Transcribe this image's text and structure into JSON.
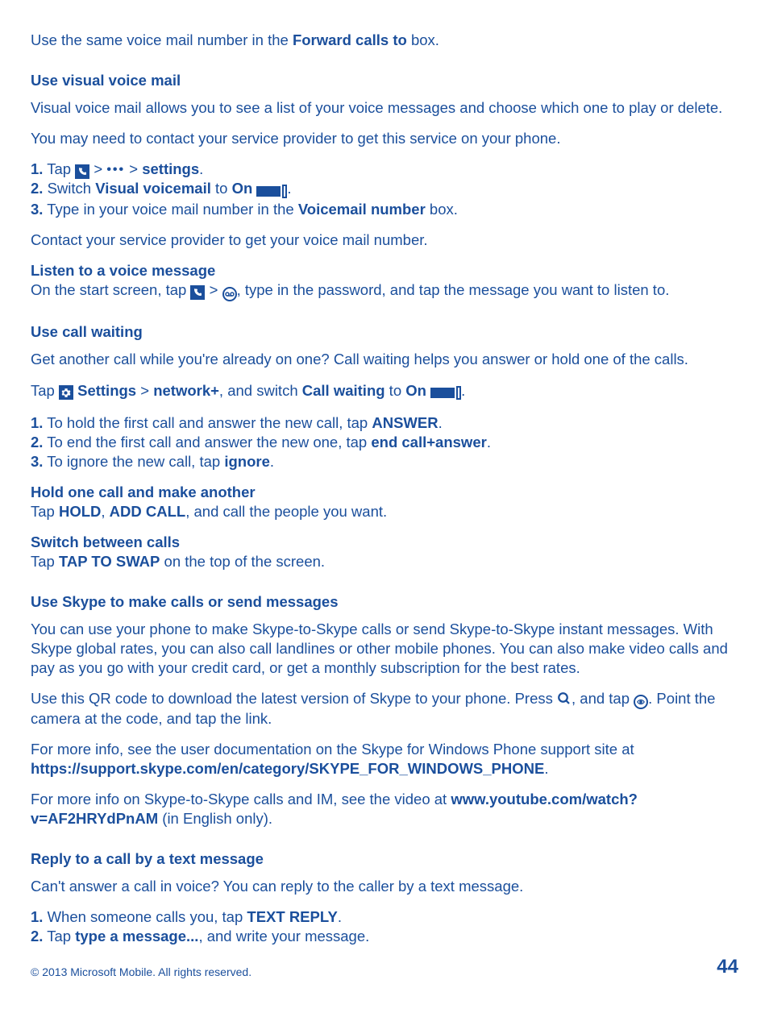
{
  "intro": {
    "p1a": "Use the same voice mail number in the ",
    "p1b": "Forward calls to",
    "p1c": " box."
  },
  "visual_vm": {
    "title": "Use visual voice mail",
    "p1": "Visual voice mail allows you to see a list of your voice messages and choose which one to play or delete.",
    "p2": "You may need to contact your service provider to get this service on your phone.",
    "s1a": "1.",
    "s1b": " Tap ",
    "s1c": " > ",
    "s1d": " > ",
    "s1e": "settings",
    "s1f": ".",
    "s2a": "2.",
    "s2b": " Switch ",
    "s2c": "Visual voicemail",
    "s2d": " to ",
    "s2e": "On",
    "s2f": " ",
    "s2g": ".",
    "s3a": "3.",
    "s3b": " Type in your voice mail number in the ",
    "s3c": "Voicemail number",
    "s3d": " box.",
    "p3": "Contact your service provider to get your voice mail number.",
    "sub1": "Listen to a voice message",
    "sub1a": "On the start screen, tap ",
    "sub1b": " > ",
    "sub1c": ", type in the password, and tap the message you want to listen to."
  },
  "call_wait": {
    "title": "Use call waiting",
    "p1": "Get another call while you're already on one? Call waiting helps you answer or hold one of the calls.",
    "p2a": "Tap ",
    "p2b": "Settings",
    "p2c": " > ",
    "p2d": "network+",
    "p2e": ", and switch ",
    "p2f": "Call waiting",
    "p2g": " to ",
    "p2h": "On",
    "p2i": " ",
    "p2j": ".",
    "s1a": "1.",
    "s1b": " To hold the first call and answer the new call, tap ",
    "s1c": "ANSWER",
    "s1d": ".",
    "s2a": "2.",
    "s2b": " To end the first call and answer the new one, tap ",
    "s2c": "end call+answer",
    "s2d": ".",
    "s3a": "3.",
    "s3b": " To ignore the new call, tap ",
    "s3c": "ignore",
    "s3d": ".",
    "sub1": "Hold one call and make another",
    "sub1a": "Tap ",
    "sub1b": "HOLD",
    "sub1c": ", ",
    "sub1d": "ADD CALL",
    "sub1e": ", and call the people you want.",
    "sub2": "Switch between calls",
    "sub2a": "Tap ",
    "sub2b": "TAP TO SWAP",
    "sub2c": " on the top of the screen."
  },
  "skype": {
    "title": "Use Skype to make calls or send messages",
    "p1": "You can use your phone to make Skype-to-Skype calls or send Skype-to-Skype instant messages. With Skype global rates, you can also call landlines or other mobile phones. You can also make video calls and pay as you go with your credit card, or get a monthly subscription for the best rates.",
    "p2a": "Use this QR code to download the latest version of Skype to your phone. Press ",
    "p2b": ", and tap ",
    "p2c": ". Point the camera at the code, and tap the link.",
    "p3a": "For more info, see the user documentation on the Skype for Windows Phone support site at ",
    "p3b": "https://support.skype.com/en/category/SKYPE_FOR_WINDOWS_PHONE",
    "p3c": ".",
    "p4a": "For more info on Skype-to-Skype calls and IM, see the video at ",
    "p4b": "www.youtube.com/watch?v=AF2HRYdPnAM",
    "p4c": " (in English only)."
  },
  "reply": {
    "title": "Reply to a call by a text message",
    "p1": "Can't answer a call in voice? You can reply to the caller by a text message.",
    "s1a": "1.",
    "s1b": " When someone calls you, tap ",
    "s1c": "TEXT REPLY",
    "s1d": ".",
    "s2a": "2.",
    "s2b": " Tap ",
    "s2c": "type a message...",
    "s2d": ", and write your message."
  },
  "footer": {
    "copyright": "© 2013 Microsoft Mobile. All rights reserved.",
    "page": "44"
  },
  "icons": {
    "dots": "•••"
  }
}
